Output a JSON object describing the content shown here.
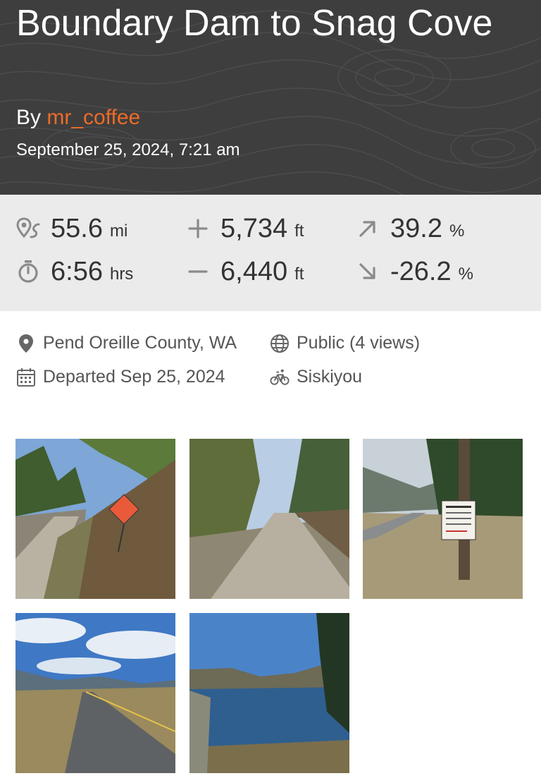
{
  "ride": {
    "title": "Boundary Dam to Snag Cove",
    "by_label": "By",
    "author": "mr_coffee",
    "datetime": "September 25, 2024, 7:21 am"
  },
  "stats": {
    "distance": {
      "value": "55.6",
      "unit": "mi",
      "icon": "map-route-icon"
    },
    "moving_time": {
      "value": "6:56",
      "unit": "hrs",
      "icon": "stopwatch-icon"
    },
    "elevation_gain": {
      "value": "5,734",
      "unit": "ft",
      "icon": "plus-icon"
    },
    "elevation_loss": {
      "value": "6,440",
      "unit": "ft",
      "icon": "minus-icon"
    },
    "max_grade": {
      "value": "39.2",
      "unit": "%",
      "icon": "arrow-up-right-icon"
    },
    "min_grade": {
      "value": "-26.2",
      "unit": "%",
      "icon": "arrow-down-right-icon"
    }
  },
  "details": {
    "location": "Pend Oreille County, WA",
    "visibility": "Public (4 views)",
    "departed": "Departed Sep 25, 2024",
    "bike": "Siskiyou"
  },
  "colors": {
    "header_bg": "#3e3e3e",
    "accent": "#ee6b26",
    "stats_bg": "#ebebeb"
  },
  "photos": [
    {
      "name": "photo-gravel-road-timber-sign"
    },
    {
      "name": "photo-gravel-road-forest"
    },
    {
      "name": "photo-road-with-signpost"
    },
    {
      "name": "photo-paved-road-valley"
    },
    {
      "name": "photo-lake-view"
    }
  ]
}
